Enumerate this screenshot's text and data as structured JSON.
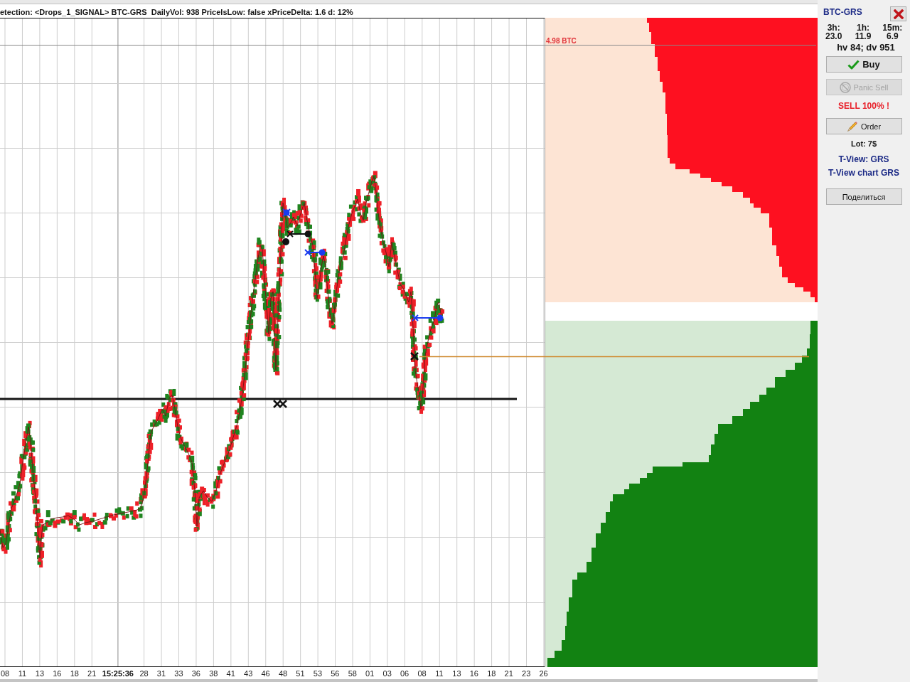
{
  "window": {
    "title": "etection: <Drops_1_SIGNAL> BTC-GRS  DailyVol: 938 PriceIsLow: false xPriceDelta: 1.6 d: 12%"
  },
  "chart": {
    "price_label": "4.98 BTC",
    "time_axis": [
      {
        "label": "08",
        "major": false
      },
      {
        "label": "11",
        "major": false
      },
      {
        "label": "13",
        "major": false
      },
      {
        "label": "16",
        "major": false
      },
      {
        "label": "18",
        "major": false
      },
      {
        "label": "21",
        "major": false
      },
      {
        "label": "15:25:36",
        "major": true
      },
      {
        "label": "28",
        "major": false
      },
      {
        "label": "31",
        "major": false
      },
      {
        "label": "33",
        "major": false
      },
      {
        "label": "36",
        "major": false
      },
      {
        "label": "38",
        "major": false
      },
      {
        "label": "41",
        "major": false
      },
      {
        "label": "43",
        "major": false
      },
      {
        "label": "46",
        "major": false
      },
      {
        "label": "48",
        "major": false
      },
      {
        "label": "51",
        "major": false
      },
      {
        "label": "53",
        "major": false
      },
      {
        "label": "56",
        "major": false
      },
      {
        "label": "58",
        "major": false
      },
      {
        "label": "01",
        "major": false
      },
      {
        "label": "03",
        "major": false
      },
      {
        "label": "06",
        "major": false
      },
      {
        "label": "08",
        "major": false
      },
      {
        "label": "11",
        "major": false
      },
      {
        "label": "13",
        "major": false
      },
      {
        "label": "16",
        "major": false
      },
      {
        "label": "18",
        "major": false
      },
      {
        "label": "21",
        "major": false
      },
      {
        "label": "23",
        "major": false
      },
      {
        "label": "26",
        "major": false
      }
    ]
  },
  "side_panel": {
    "pair": "BTC-GRS",
    "stats": [
      {
        "label": "3h:",
        "value": "23.0"
      },
      {
        "label": "1h:",
        "value": "11.9"
      },
      {
        "label": "15m:",
        "value": "6.9"
      }
    ],
    "volume_summary": "hv 84; dv 951",
    "buy_button": {
      "label": "Buy",
      "disabled": false
    },
    "panic_sell_button": {
      "label": "Panic Sell",
      "disabled": true
    },
    "sell_alert": "SELL 100% !",
    "order_button": {
      "label": "Order",
      "disabled": false
    },
    "lot": "Lot: 7$",
    "links": [
      "T-View: GRS",
      "T-View chart GRS"
    ],
    "share_button": {
      "label": "Поделиться",
      "disabled": false
    }
  }
}
